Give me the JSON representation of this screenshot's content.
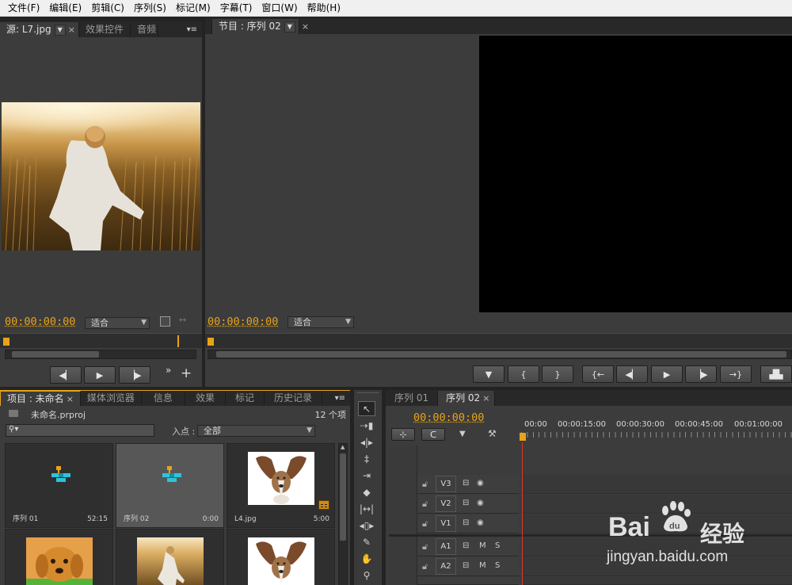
{
  "menu": [
    "文件(F)",
    "编辑(E)",
    "剪辑(C)",
    "序列(S)",
    "标记(M)",
    "字幕(T)",
    "窗口(W)",
    "帮助(H)"
  ],
  "source_panel": {
    "tabs": [
      "源: L7.jpg",
      "效果控件",
      "音频"
    ],
    "timecode": "00:00:00:00",
    "fit": "适合"
  },
  "program_panel": {
    "tab": "节目 : 序列 02",
    "timecode": "00:00:00:00",
    "fit": "适合"
  },
  "project_panel": {
    "tabs": [
      "项目 : 未命名",
      "媒体浏览器",
      "信息",
      "效果",
      "标记",
      "历史记录"
    ],
    "file": "未命名.prproj",
    "count": "12 个项",
    "search_placeholder": "",
    "in_point_label": "入点 :",
    "in_point_value": "全部",
    "items": [
      {
        "name": "序列 01",
        "duration": "52:15",
        "kind": "sequence"
      },
      {
        "name": "序列 02",
        "duration": "0:00",
        "kind": "sequence"
      },
      {
        "name": "L4.jpg",
        "duration": "5:00",
        "kind": "dog"
      },
      {
        "name": "",
        "duration": "",
        "kind": "puppy"
      },
      {
        "name": "",
        "duration": "",
        "kind": "field"
      },
      {
        "name": "",
        "duration": "",
        "kind": "dog"
      }
    ]
  },
  "timeline": {
    "tabs": [
      "序列 01",
      "序列 02"
    ],
    "timecode": "00:00:00:00",
    "ruler": [
      "00:00",
      "00:00:15:00",
      "00:00:30:00",
      "00:00:45:00",
      "00:01:00:00"
    ],
    "video_tracks": [
      "V3",
      "V2",
      "V1"
    ],
    "audio_tracks": [
      "A1",
      "A2"
    ],
    "audio_mute": "M",
    "audio_solo": "S"
  },
  "watermark": {
    "brand": "Bai",
    "brand2": "经验",
    "url": "jingyan.baidu.com"
  },
  "colors": {
    "timecode": "#e8a317",
    "playhead": "#d83a2a",
    "panel": "#3c3c3c",
    "bg": "#232323"
  }
}
